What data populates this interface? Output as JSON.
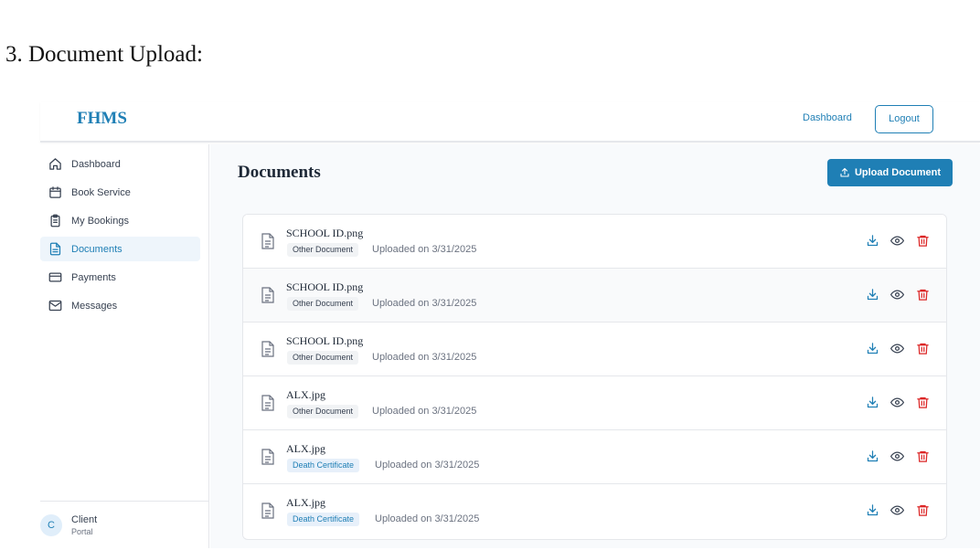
{
  "page_heading": "3.  Document Upload:",
  "app": {
    "brand": "FHMS",
    "top_nav": {
      "dashboard_link": "Dashboard",
      "logout": "Logout"
    },
    "sidebar": {
      "items": [
        {
          "label": "Dashboard",
          "icon": "home-icon",
          "active": false
        },
        {
          "label": "Book Service",
          "icon": "calendar-icon",
          "active": false
        },
        {
          "label": "My Bookings",
          "icon": "clipboard-icon",
          "active": false
        },
        {
          "label": "Documents",
          "icon": "document-icon",
          "active": true
        },
        {
          "label": "Payments",
          "icon": "credit-card-icon",
          "active": false
        },
        {
          "label": "Messages",
          "icon": "mail-icon",
          "active": false
        }
      ],
      "user": {
        "initial": "C",
        "name": "Client",
        "role": "Portal"
      }
    },
    "main": {
      "title": "Documents",
      "upload_button": "Upload Document",
      "documents": [
        {
          "name": "SCHOOL ID.png",
          "type": "Other Document",
          "uploaded": "Uploaded on 3/31/2025"
        },
        {
          "name": "SCHOOL ID.png",
          "type": "Other Document",
          "uploaded": "Uploaded on 3/31/2025"
        },
        {
          "name": "SCHOOL ID.png",
          "type": "Other Document",
          "uploaded": "Uploaded on 3/31/2025"
        },
        {
          "name": "ALX.jpg",
          "type": "Other Document",
          "uploaded": "Uploaded on 3/31/2025"
        },
        {
          "name": "ALX.jpg",
          "type": "Death Certificate",
          "uploaded": "Uploaded on 3/31/2025"
        },
        {
          "name": "ALX.jpg",
          "type": "Death Certificate",
          "uploaded": "Uploaded on 3/31/2025"
        }
      ]
    }
  },
  "colors": {
    "brand": "#1f7fb5",
    "delete": "#dc2626",
    "active_bg": "#eef5fb"
  }
}
